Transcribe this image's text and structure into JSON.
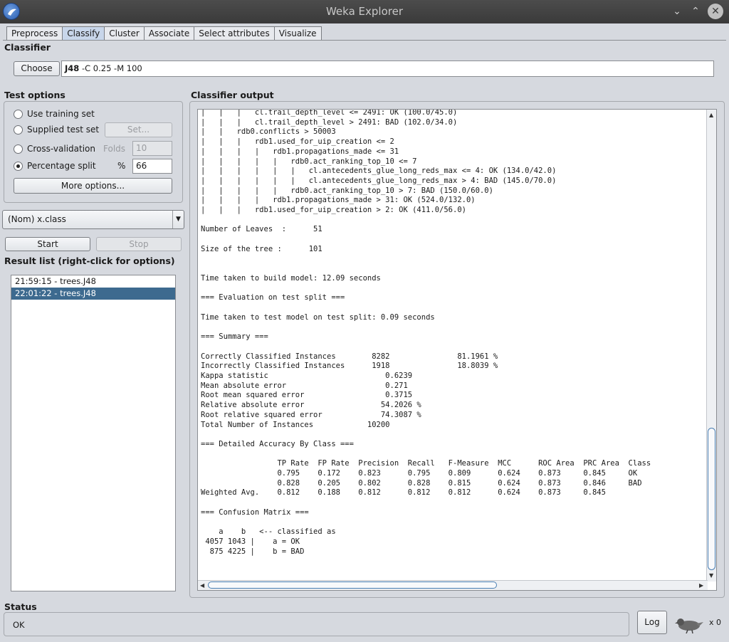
{
  "window": {
    "title": "Weka Explorer"
  },
  "tabs": [
    "Preprocess",
    "Classify",
    "Cluster",
    "Associate",
    "Select attributes",
    "Visualize"
  ],
  "active_tab": "Classify",
  "classifier": {
    "section": "Classifier",
    "choose_label": "Choose",
    "name": "J48",
    "options": "-C 0.25 -M 100"
  },
  "test_options": {
    "section": "Test options",
    "use_training": "Use training set",
    "supplied_test": "Supplied test set",
    "set_label": "Set...",
    "cross_validation": "Cross-validation",
    "folds_label": "Folds",
    "folds_value": "10",
    "percentage_split": "Percentage split",
    "percent_label": "%",
    "percent_value": "66",
    "more_options": "More options..."
  },
  "class_select": "(Nom) x.class",
  "start_label": "Start",
  "stop_label": "Stop",
  "result_list": {
    "label": "Result list (right-click for options)",
    "items": [
      "21:59:15 - trees.J48",
      "22:01:22 - trees.J48"
    ]
  },
  "output": {
    "label": "Classifier output",
    "lines": [
      "|   |   |   cl.trail_depth_level <= 2491: OK (100.0/45.0)",
      "|   |   |   cl.trail_depth_level > 2491: BAD (102.0/34.0)",
      "|   |   rdb0.conflicts > 50003",
      "|   |   |   rdb1.used_for_uip_creation <= 2",
      "|   |   |   |   rdb1.propagations_made <= 31",
      "|   |   |   |   |   rdb0.act_ranking_top_10 <= 7",
      "|   |   |   |   |   |   cl.antecedents_glue_long_reds_max <= 4: OK (134.0/42.0)",
      "|   |   |   |   |   |   cl.antecedents_glue_long_reds_max > 4: BAD (145.0/70.0)",
      "|   |   |   |   |   rdb0.act_ranking_top_10 > 7: BAD (150.0/60.0)",
      "|   |   |   |   rdb1.propagations_made > 31: OK (524.0/132.0)",
      "|   |   |   rdb1.used_for_uip_creation > 2: OK (411.0/56.0)",
      "",
      "Number of Leaves  :      51",
      "",
      "Size of the tree :      101",
      "",
      "",
      "Time taken to build model: 12.09 seconds",
      "",
      "=== Evaluation on test split ===",
      "",
      "Time taken to test model on test split: 0.09 seconds",
      "",
      "=== Summary ===",
      "",
      "Correctly Classified Instances        8282               81.1961 %",
      "Incorrectly Classified Instances      1918               18.8039 %",
      "Kappa statistic                          0.6239",
      "Mean absolute error                      0.271",
      "Root mean squared error                  0.3715",
      "Relative absolute error                 54.2026 %",
      "Root relative squared error             74.3087 %",
      "Total Number of Instances            10200",
      "",
      "=== Detailed Accuracy By Class ===",
      "",
      "                 TP Rate  FP Rate  Precision  Recall   F-Measure  MCC      ROC Area  PRC Area  Class",
      "                 0.795    0.172    0.823      0.795    0.809      0.624    0.873     0.845     OK",
      "                 0.828    0.205    0.802      0.828    0.815      0.624    0.873     0.846     BAD",
      "Weighted Avg.    0.812    0.188    0.812      0.812    0.812      0.624    0.873     0.845",
      "",
      "=== Confusion Matrix ===",
      "",
      "    a    b   <-- classified as",
      " 4057 1043 |    a = OK",
      "  875 4225 |    b = BAD"
    ]
  },
  "status": {
    "label": "Status",
    "text": "OK",
    "log_label": "Log",
    "count": "x 0"
  }
}
